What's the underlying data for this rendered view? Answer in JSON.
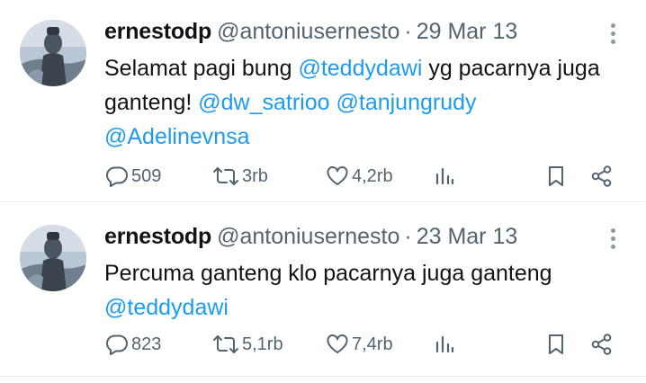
{
  "tweets": [
    {
      "name": "ernestodp",
      "handle": "@antoniusernesto",
      "separator": "·",
      "date": "29 Mar 13",
      "text_parts": [
        {
          "text": "Selamat pagi bung ",
          "mention": false
        },
        {
          "text": "@teddydawi",
          "mention": true
        },
        {
          "text": " yg pacarnya juga ganteng! ",
          "mention": false
        },
        {
          "text": "@dw_satrioo",
          "mention": true
        },
        {
          "text": " ",
          "mention": false
        },
        {
          "text": "@tanjungrudy",
          "mention": true
        },
        {
          "text": " ",
          "mention": false
        },
        {
          "text": "@Adelinevnsa",
          "mention": true
        }
      ],
      "replies": "509",
      "reposts": "3rb",
      "likes": "4,2rb"
    },
    {
      "name": "ernestodp",
      "handle": "@antoniusernesto",
      "separator": "·",
      "date": "23 Mar 13",
      "text_parts": [
        {
          "text": "Percuma ganteng klo pacarnya juga ganteng ",
          "mention": false
        },
        {
          "text": "@teddydawi",
          "mention": true
        }
      ],
      "replies": "823",
      "reposts": "5,1rb",
      "likes": "7,4rb"
    }
  ],
  "icons": {
    "more": "more-vertical-icon",
    "reply": "reply-icon",
    "repost": "repost-icon",
    "like": "heart-icon",
    "views": "views-chart-icon",
    "bookmark": "bookmark-icon",
    "share": "share-icon"
  },
  "colors": {
    "text": "#0f1419",
    "secondary": "#536471",
    "mention": "#1d9bf0",
    "divider": "#e6e9ec"
  }
}
